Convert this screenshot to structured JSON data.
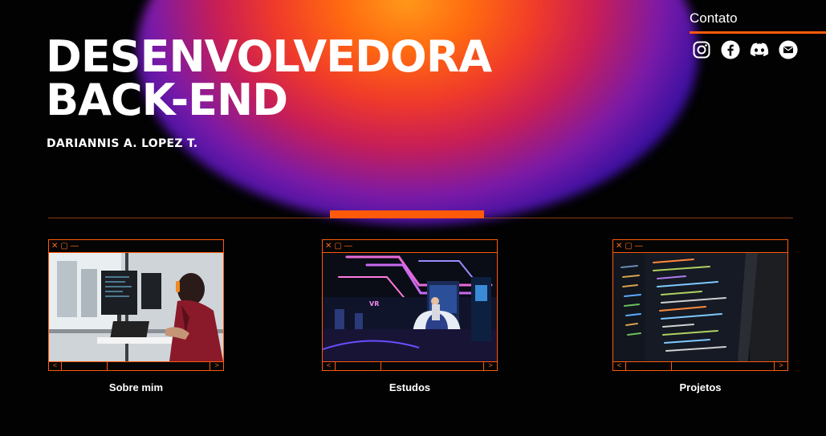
{
  "hero": {
    "title_line1": "DESENVOLVEDORA",
    "title_line2": "BACK-END",
    "author": "DARIANNIS A. LOPEZ T."
  },
  "contact": {
    "title": "Contato",
    "icons": [
      "instagram-icon",
      "facebook-icon",
      "discord-icon",
      "email-icon"
    ]
  },
  "window_controls": {
    "close": "✕",
    "max": "▢",
    "min": "—",
    "prev": "<",
    "next": ">"
  },
  "cards": [
    {
      "label": "Sobre mim"
    },
    {
      "label": "Estudos"
    },
    {
      "label": "Projetos"
    }
  ],
  "colors": {
    "accent": "#ff5a0a",
    "background": "#020203"
  }
}
